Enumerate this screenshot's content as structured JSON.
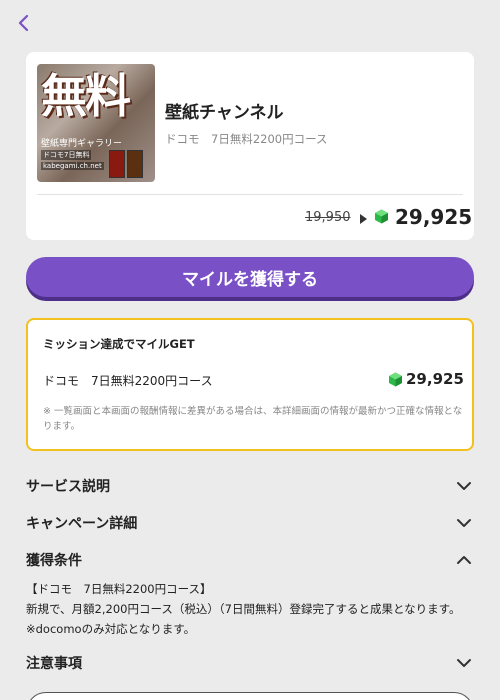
{
  "header": {
    "back_icon": "chevron-left-icon",
    "accent_color": "#7950c6"
  },
  "offer": {
    "thumbnail": {
      "headline": "無料",
      "caption1": "壁紙専門ギャラリー",
      "caption2": "ドコモ7日無料",
      "caption3": "kabegami.ch.net"
    },
    "title": "壁紙チャンネル",
    "subtitle": "ドコモ　7日無料2200円コース",
    "old_price": "19,950",
    "new_price": "29,925",
    "gem_icon": "green-gem-icon"
  },
  "cta": {
    "label": "マイルを獲得する",
    "color": "#7950c6"
  },
  "mission": {
    "title": "ミッション達成でマイルGET",
    "course": "ドコモ　7日無料2200円コース",
    "price": "29,925",
    "note": "※ 一覧画面と本画面の報酬情報に差異がある場合は、本詳細画面の情報が最新かつ正確な情報となります。",
    "border_color": "#f2c01f"
  },
  "sections": {
    "service": {
      "label": "サービス説明",
      "expanded": false
    },
    "campaign": {
      "label": "キャンペーン詳細",
      "expanded": false
    },
    "conditions": {
      "label": "獲得条件",
      "expanded": true,
      "line1": "【ドコモ　7日無料2200円コース】",
      "line2": "新規で、月額2,200円コース（税込）（7日間無料）登録完了すると成果となります。",
      "line3": "※docomoのみ対応となります。"
    },
    "notes": {
      "label": "注意事項",
      "expanded": false
    }
  }
}
